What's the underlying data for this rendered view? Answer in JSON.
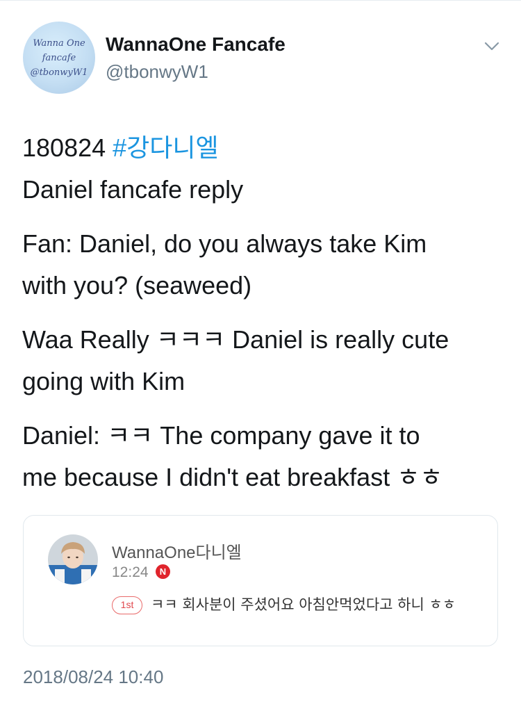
{
  "author": {
    "display_name": "WannaOne Fancafe",
    "handle": "@tbonwyW1",
    "avatar_text": [
      "Wanna One",
      "fancafe",
      "@tbonwyW1"
    ]
  },
  "tweet": {
    "line1_date": "180824",
    "line1_hashtag": "#강다니엘",
    "line2": "Daniel fancafe reply",
    "fan_question_1": "Fan: Daniel, do you always take Kim",
    "fan_question_2": "with you? (seaweed)",
    "fan_comment_1": "Waa Really ㅋㅋㅋ Daniel is really cute",
    "fan_comment_2": "going with Kim",
    "daniel_reply_1": "Daniel: ㅋㅋ The company gave it to",
    "daniel_reply_2": "me because I didn't eat breakfast ㅎㅎ",
    "timestamp": "2018/08/24 10:40"
  },
  "card": {
    "name": "WannaOne다니엘",
    "time": "12:24",
    "badge": "N",
    "rank": "1st",
    "reply": "ㅋㅋ 회사분이 주셨어요 아침안먹었다고 하니 ㅎㅎ"
  },
  "icons": {
    "menu": "chevron-down-icon",
    "new_badge": "new-badge-icon"
  },
  "colors": {
    "link": "#1b95e0",
    "secondary_text": "#657786",
    "badge_red": "#e0242c"
  }
}
